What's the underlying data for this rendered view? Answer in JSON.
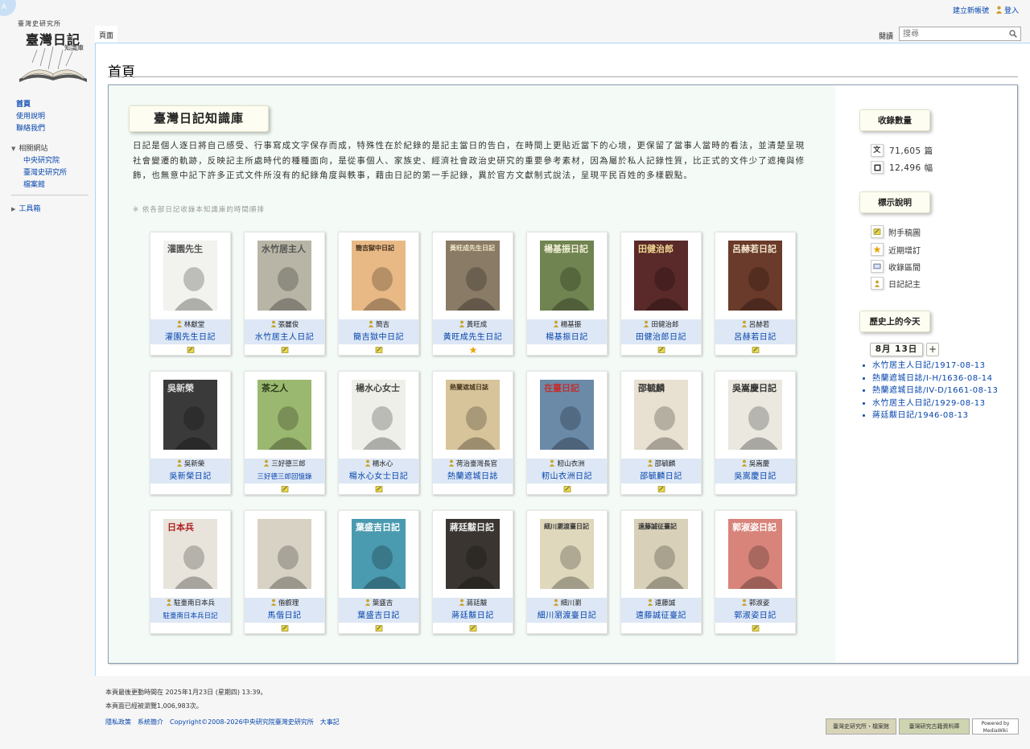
{
  "personal": {
    "create_account": "建立新帳號",
    "login": "登入"
  },
  "logo": {
    "line1": "臺灣史研究所",
    "line2": "臺灣日記",
    "line3": "知識庫"
  },
  "tabs": {
    "main": "頁面",
    "read": "閱讀"
  },
  "search": {
    "placeholder": "搜尋"
  },
  "sidebar": {
    "nav": [
      "首頁",
      "使用說明",
      "聯絡我們"
    ],
    "related_head": "相關網站",
    "related": [
      "中央研究院",
      "臺灣史研究所",
      "檔案館"
    ],
    "toolbox": "工具箱"
  },
  "page": {
    "title": "首頁",
    "kb_title": "臺灣日記知識庫",
    "intro": "日記是個人逐日將自己感受、行事寫成文字保存而成，特殊性在於紀錄的是記主當日的告白，在時間上更貼近當下的心境，更保留了當事人當時的看法，並清楚呈現社會變遷的軌跡，反映記主所處時代的種種面向，是從事個人、家族史、經濟社會政治史研究的重要參考素材，因為屬於私人記錄性質，比正式的文件少了遮掩與修飾，也無意中記下許多正式文件所沒有的紀錄角度與軼事，藉由日記的第一手記錄，異於官方文獻制式說法，呈現平民百姓的多樣觀點。",
    "note": "※ 依各部日記收錄本知識庫的時間順排"
  },
  "diaries": [
    {
      "author": "林獻堂",
      "title": "灌園先生日記",
      "badge": "manuscript",
      "cover": {
        "bg": "#f2f2ee",
        "fg": "#555",
        "text": "灌園先生"
      }
    },
    {
      "author": "張麗俊",
      "title": "水竹居主人日記",
      "badge": "manuscript",
      "cover": {
        "bg": "#b8b5a6",
        "fg": "#555",
        "text": "水竹居主人"
      }
    },
    {
      "author": "簡吉",
      "title": "簡吉獄中日記",
      "badge": "manuscript",
      "cover": {
        "bg": "#e8b985",
        "fg": "#3a2a1a",
        "text": "簡吉獄中日記"
      }
    },
    {
      "author": "黃旺成",
      "title": "黃旺成先生日記",
      "badge": "recent",
      "cover": {
        "bg": "#8a7b66",
        "fg": "#f0e6c8",
        "text": "黃旺成先生日記"
      }
    },
    {
      "author": "楊基振",
      "title": "楊基振日記",
      "badge": "",
      "cover": {
        "bg": "#6f8450",
        "fg": "#f4f0d8",
        "text": "楊基振日記"
      }
    },
    {
      "author": "田健治郎",
      "title": "田健治郎日記",
      "badge": "manuscript",
      "cover": {
        "bg": "#5a2a2a",
        "fg": "#f0d890",
        "text": "田健治郎"
      }
    },
    {
      "author": "呂赫若",
      "title": "呂赫若日記",
      "badge": "manuscript",
      "cover": {
        "bg": "#6a3a2a",
        "fg": "#f4e8d0",
        "text": "呂赫若日記"
      }
    },
    {
      "author": "吳新榮",
      "title": "吳新榮日記",
      "badge": "",
      "cover": {
        "bg": "#3a3a3a",
        "fg": "#dddddd",
        "text": "吳新榮"
      }
    },
    {
      "author": "三好德三郎",
      "title": "三好德三郎回憶錄",
      "badge": "manuscript",
      "cover": {
        "bg": "#9bb870",
        "fg": "#2a3a1a",
        "text": "茶之人"
      }
    },
    {
      "author": "楊水心",
      "title": "楊水心女士日記",
      "badge": "manuscript",
      "cover": {
        "bg": "#efefea",
        "fg": "#444",
        "text": "楊水心女士"
      }
    },
    {
      "author": "荷治臺灣長官",
      "title": "熱蘭遮城日誌",
      "badge": "",
      "cover": {
        "bg": "#d8c49a",
        "fg": "#4a3a20",
        "text": "熱蘭遮城日誌"
      }
    },
    {
      "author": "籾山衣洲",
      "title": "籾山衣洲日記",
      "badge": "manuscript",
      "cover": {
        "bg": "#6a8aa8",
        "fg": "#c03030",
        "text": "在臺日記"
      }
    },
    {
      "author": "邵毓麟",
      "title": "邵毓麟日記",
      "badge": "manuscript",
      "cover": {
        "bg": "#e8e0d0",
        "fg": "#333",
        "text": "邵毓麟"
      }
    },
    {
      "author": "吳嵩慶",
      "title": "吳嵩慶日記",
      "badge": "",
      "cover": {
        "bg": "#ebe8e0",
        "fg": "#333",
        "text": "吳嵩慶日記"
      }
    },
    {
      "author": "駐臺南日本兵",
      "title": "駐臺南日本兵日記",
      "badge": "",
      "cover": {
        "bg": "#e8e4dc",
        "fg": "#b02020",
        "text": "日本兵"
      }
    },
    {
      "author": "偕叡理",
      "title": "馬偕日記",
      "badge": "manuscript",
      "cover": {
        "bg": "#d8d2c4",
        "fg": "#3a3a3a",
        "text": ""
      }
    },
    {
      "author": "葉盛吉",
      "title": "葉盛吉日記",
      "badge": "manuscript",
      "cover": {
        "bg": "#4a9ab0",
        "fg": "#ffffff",
        "text": "葉盛吉日記"
      }
    },
    {
      "author": "蔣廷黻",
      "title": "蔣廷黻日記",
      "badge": "manuscript",
      "cover": {
        "bg": "#3a3530",
        "fg": "#f0f0f0",
        "text": "蔣廷黻日記"
      }
    },
    {
      "author": "細川瀏",
      "title": "細川瀏渡臺日記",
      "badge": "",
      "cover": {
        "bg": "#e0d8bc",
        "fg": "#3a3a3a",
        "text": "細川瀏渡臺日記"
      }
    },
    {
      "author": "遠藤誠",
      "title": "遠藤誠征臺記",
      "badge": "",
      "cover": {
        "bg": "#d8d0b8",
        "fg": "#333",
        "text": "遠藤誠征臺記"
      }
    },
    {
      "author": "郭淑姿",
      "title": "郭淑姿日記",
      "badge": "manuscript",
      "cover": {
        "bg": "#d8847a",
        "fg": "#ffffff",
        "text": "郭淑姿日記"
      }
    }
  ],
  "stats": {
    "title": "收錄數量",
    "articles_icon": "文",
    "articles": "71,605 篇",
    "images": "12,496 幅"
  },
  "legend": {
    "title": "標示說明",
    "items": [
      {
        "icon": "manuscript-icon",
        "label": "附手稿圖"
      },
      {
        "icon": "star-icon",
        "label": "近期增訂"
      },
      {
        "icon": "gallery-icon",
        "label": "收錄區間"
      },
      {
        "icon": "user-icon",
        "label": "日記記主"
      }
    ]
  },
  "today": {
    "title": "歷史上的今天",
    "date": "8月 13日",
    "plus": "+",
    "entries": [
      "水竹居主人日記/1917-08-13",
      "熱蘭遮城日誌/I-H/1636-08-14",
      "熱蘭遮城日誌/IV-D/1661-08-13",
      "水竹居主人日記/1929-08-13",
      "蔣廷黻日記/1946-08-13"
    ]
  },
  "footer": {
    "modified": "本頁最後更動時間在 2025年1月23日 (星期四) 13:39。",
    "views": "本頁面已經被瀏覽1,006,983次。",
    "links": [
      "隱私政策",
      "系統簡介",
      "Copyright©2008-2026中央研究院臺灣史研究所",
      "大事記"
    ],
    "badges": [
      "臺灣史研究所・檔案館",
      "臺灣研究古籍資料庫",
      "Powered by MediaWiki"
    ]
  },
  "colors": {
    "link": "#0645ad",
    "panel_bg": "#f4fbf6",
    "card_band": "#dde7f5"
  }
}
